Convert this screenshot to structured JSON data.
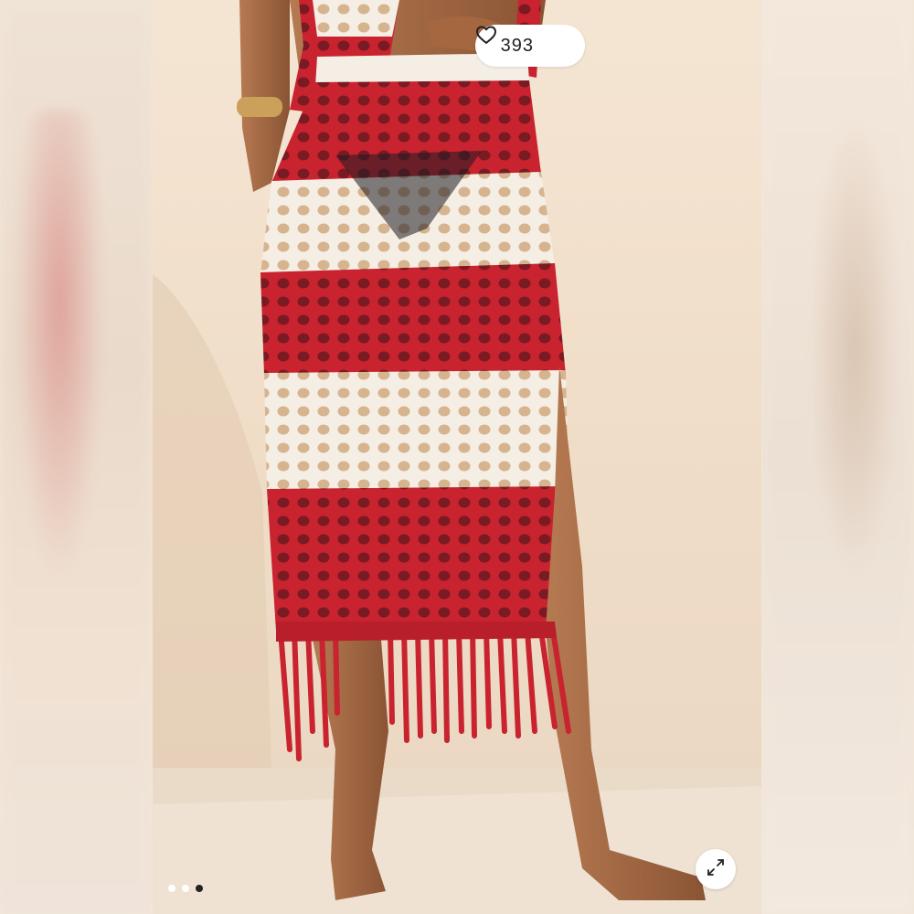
{
  "listing": {
    "like_count": "393",
    "like_icon": "heart-icon",
    "expand_icon": "expand-icon"
  },
  "carousel": {
    "slide_count": 3,
    "active_index": 2
  },
  "colors": {
    "skirt_red": "#c8232f",
    "skirt_cream": "#f5eee4",
    "background": "#f2e4d4"
  }
}
